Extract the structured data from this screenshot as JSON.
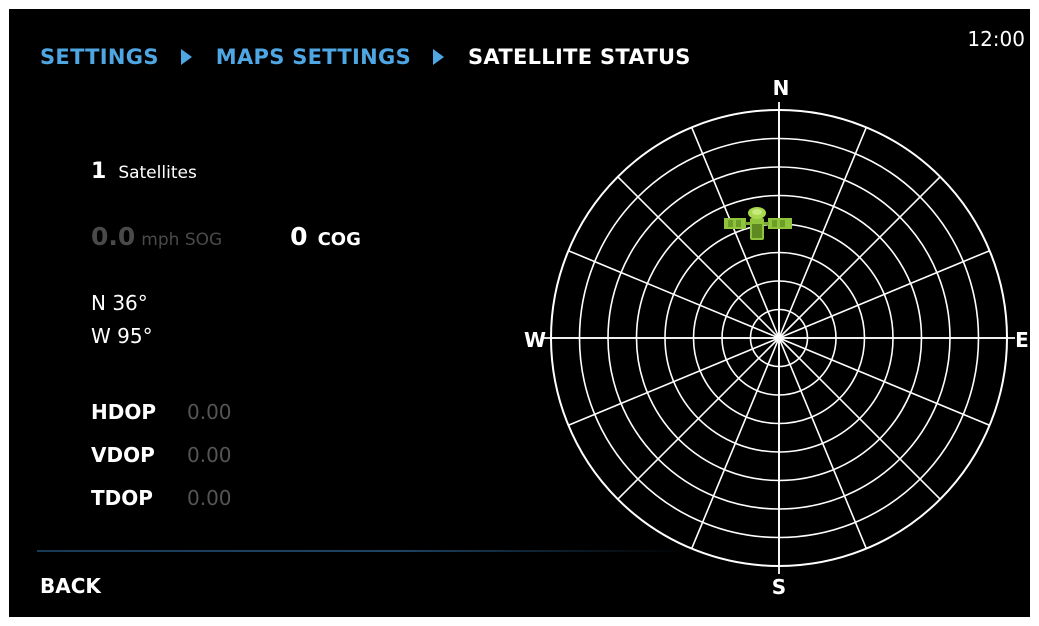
{
  "breadcrumb": {
    "items": [
      "SETTINGS",
      "MAPS SETTINGS"
    ],
    "current": "SATELLITE STATUS"
  },
  "clock": "12:00",
  "satellites": {
    "count": "1",
    "label": "Satellites"
  },
  "speed": {
    "sog_value": "0.0",
    "sog_unit": "mph SOG",
    "cog_value": "0",
    "cog_label": "COG"
  },
  "position": {
    "lat": "N 36°",
    "lon": "W 95°"
  },
  "dop": [
    {
      "label": "HDOP",
      "value": "0.00"
    },
    {
      "label": "VDOP",
      "value": "0.00"
    },
    {
      "label": "TDOP",
      "value": "0.00"
    }
  ],
  "compass": {
    "north": "N",
    "south": "S",
    "east": "E",
    "west": "W"
  },
  "back_label": "BACK",
  "colors": {
    "accent": "#4ea6e2",
    "satellite": "#8fc43c",
    "dim_text": "#4a4a4a"
  },
  "icons": {
    "breadcrumb_separator": "triangle-right-icon",
    "satellite": "satellite-icon"
  }
}
